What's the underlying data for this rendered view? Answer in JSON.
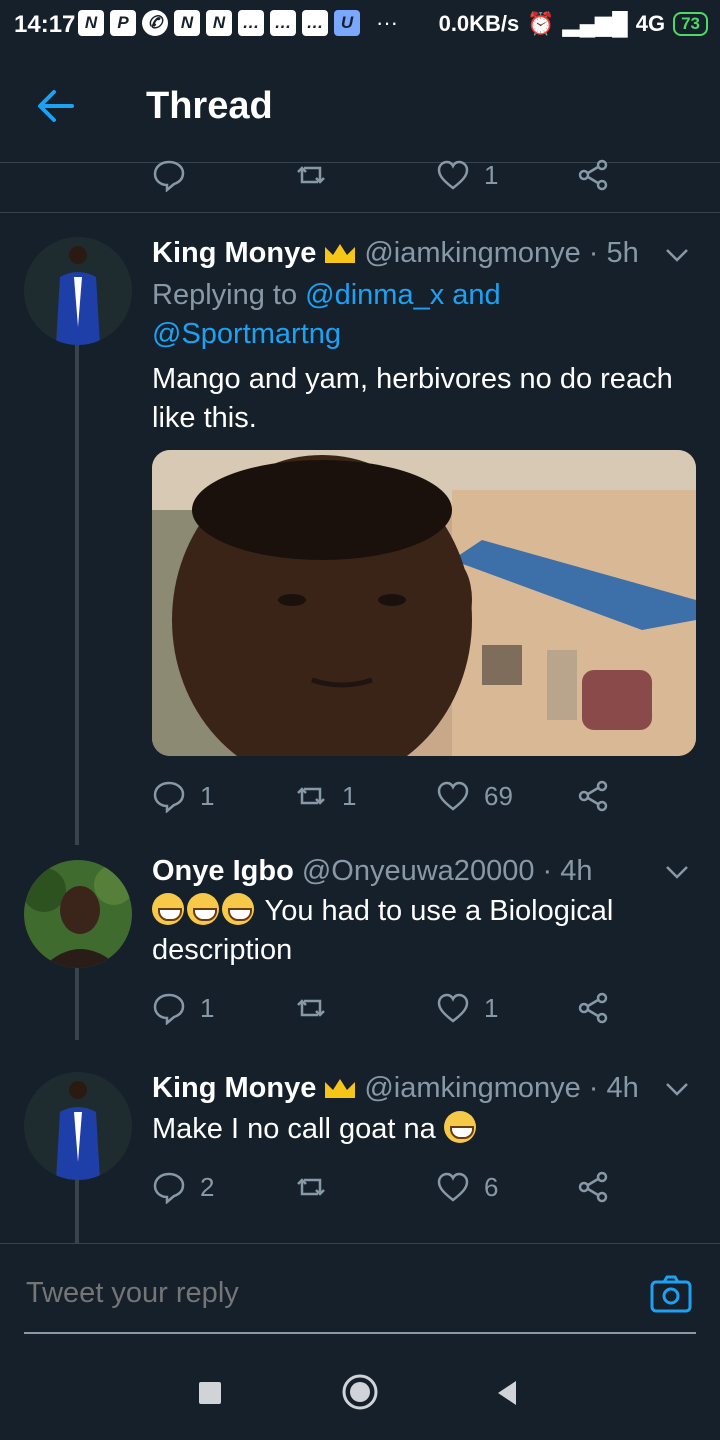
{
  "status_bar": {
    "time": "14:17",
    "speed": "0.0KB/s",
    "network": "4G",
    "battery": "73",
    "app_icons": [
      "N",
      "P",
      "whatsapp",
      "N",
      "N",
      "chat",
      "chat",
      "chat",
      "u"
    ]
  },
  "header": {
    "title": "Thread"
  },
  "top_actions": {
    "like_count": "1"
  },
  "tweets": [
    {
      "name": "King Monye",
      "handle": "@iamkingmonye · 5h",
      "replying_prefix": "Replying to ",
      "replying_user1": "@dinma_x",
      "replying_and": " and",
      "replying_user2": "@Sportmartng",
      "text": "Mango and yam, herbivores no do reach like this.",
      "reply_count": "1",
      "retweet_count": "1",
      "like_count": "69"
    },
    {
      "name": "Onye Igbo",
      "handle": "@Onyeuwa20000 · 4h",
      "text": "You had to use a Biological description",
      "reply_count": "1",
      "retweet_count": "",
      "like_count": "1"
    },
    {
      "name": "King Monye",
      "handle": "@iamkingmonye · 4h",
      "text": "Make I no call goat na",
      "reply_count": "2",
      "retweet_count": "",
      "like_count": "6"
    }
  ],
  "reply": {
    "placeholder": "Tweet your reply"
  },
  "colors": {
    "background": "#15202b",
    "accent": "#1da1f2",
    "muted": "#8899a6",
    "divider": "#38444d"
  }
}
